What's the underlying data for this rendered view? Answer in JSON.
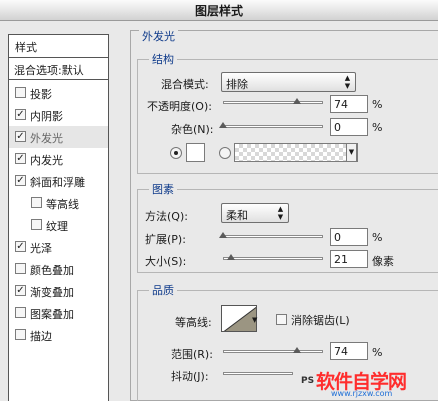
{
  "window_title": "图层样式",
  "sidebar": {
    "header": "样式",
    "blend": "混合选项:默认",
    "items": [
      {
        "label": "投影",
        "checked": false
      },
      {
        "label": "内阴影",
        "checked": true
      },
      {
        "label": "外发光",
        "checked": true,
        "selected": true
      },
      {
        "label": "内发光",
        "checked": true
      },
      {
        "label": "斜面和浮雕",
        "checked": true
      },
      {
        "label": "等高线",
        "checked": false,
        "indent": true
      },
      {
        "label": "纹理",
        "checked": false,
        "indent": true
      },
      {
        "label": "光泽",
        "checked": true
      },
      {
        "label": "颜色叠加",
        "checked": false
      },
      {
        "label": "渐变叠加",
        "checked": true
      },
      {
        "label": "图案叠加",
        "checked": false
      },
      {
        "label": "描边",
        "checked": false
      }
    ]
  },
  "outer_glow": {
    "title": "外发光",
    "structure": {
      "title": "结构",
      "blend_mode_label": "混合模式:",
      "blend_mode_value": "排除",
      "opacity_label": "不透明度(O):",
      "opacity_value": "74",
      "opacity_unit": "%",
      "opacity_fraction": 0.74,
      "noise_label": "杂色(N):",
      "noise_value": "0",
      "noise_unit": "%",
      "noise_fraction": 0
    },
    "elements": {
      "title": "图素",
      "method_label": "方法(Q):",
      "method_value": "柔和",
      "spread_label": "扩展(P):",
      "spread_value": "0",
      "spread_unit": "%",
      "spread_fraction": 0,
      "size_label": "大小(S):",
      "size_value": "21",
      "size_unit": "像素",
      "size_fraction": 0.08
    },
    "quality": {
      "title": "品质",
      "contour_label": "等高线:",
      "antialias_label": "消除锯齿(L)",
      "antialias_checked": false,
      "range_label": "范围(R):",
      "range_value": "74",
      "range_unit": "%",
      "range_fraction": 0.74,
      "jitter_label": "抖动(J):"
    }
  },
  "watermark": {
    "ps_text": "PS",
    "site_name": "软件自学网",
    "url": "www.rjzxw.com"
  },
  "colors": {
    "accent_blue": "#0e3a8a",
    "watermark_red": "#ff2d2d",
    "watermark_blue": "#1f6fd6"
  }
}
